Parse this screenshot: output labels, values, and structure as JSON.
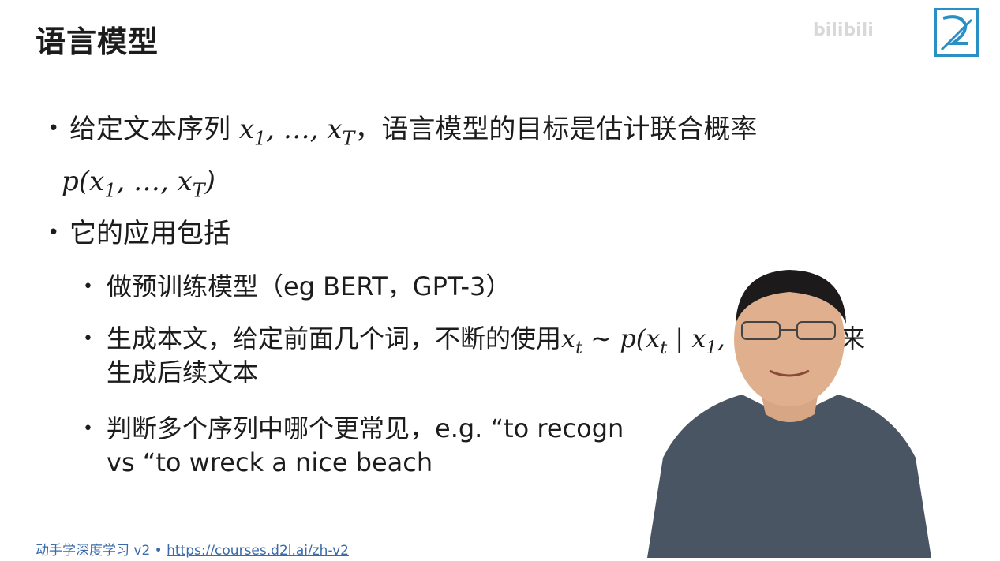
{
  "slide": {
    "title": "语言模型",
    "bullets": {
      "b1_text": "给定文本序列",
      "b1_mid": "，语言模型的目标是估计联合概率",
      "b2_text": "它的应用包括",
      "sub1": "做预训练模型（eg BERT，GPT-3）",
      "sub2_a": "生成本文，给定前面几个词，不断的使用",
      "sub2_b": "来",
      "sub2_line2": "生成后续文本",
      "sub3_a": "判断多个序列中哪个更常见，e.g. “to recogn",
      "sub3_line2": "vs “to wreck a nice beach"
    }
  },
  "footer": {
    "text": "动手学深度学习 v2 • ",
    "link": "https://courses.d2l.ai/zh-v2"
  },
  "watermark": "bilibili",
  "colors": {
    "accent": "#2a8fc4",
    "footer": "#3a6aa8",
    "shirt": "#4a5563"
  },
  "icons": {
    "logo": "d2l-logo-icon"
  }
}
